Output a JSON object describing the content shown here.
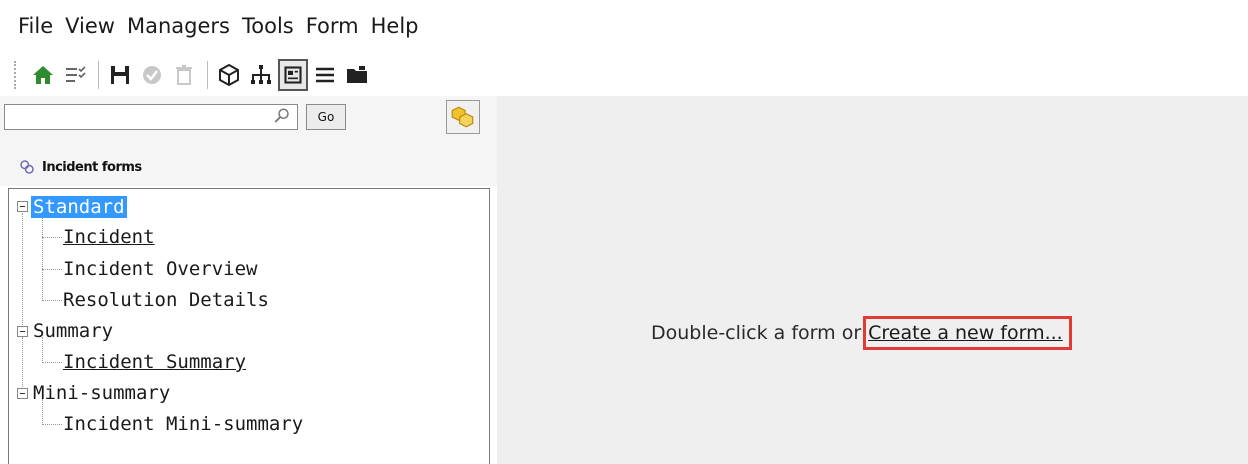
{
  "menu": {
    "items": [
      "File",
      "View",
      "Managers",
      "Tools",
      "Form",
      "Help"
    ]
  },
  "toolbar": {
    "icons": [
      "home-icon",
      "checklist-icon",
      "save-icon",
      "check-circle-icon",
      "trash-icon",
      "cube-icon",
      "hierarchy-icon",
      "form-view-icon",
      "list-icon",
      "folder-icon"
    ]
  },
  "search": {
    "value": "",
    "placeholder": "",
    "go_label": "Go"
  },
  "forms_panel": {
    "title": "Incident forms"
  },
  "tree": {
    "groups": [
      {
        "label": "Standard",
        "children": [
          "Incident",
          "Incident Overview",
          "Resolution Details"
        ]
      },
      {
        "label": "Summary",
        "children": [
          "Incident Summary"
        ]
      },
      {
        "label": "Mini-summary",
        "children": [
          "Incident Mini-summary"
        ]
      }
    ]
  },
  "main": {
    "hint_text": "Double-click a form or",
    "create_link": "Create a new form..."
  },
  "colors": {
    "selection": "#3399ff",
    "highlight_box": "#e53935"
  }
}
